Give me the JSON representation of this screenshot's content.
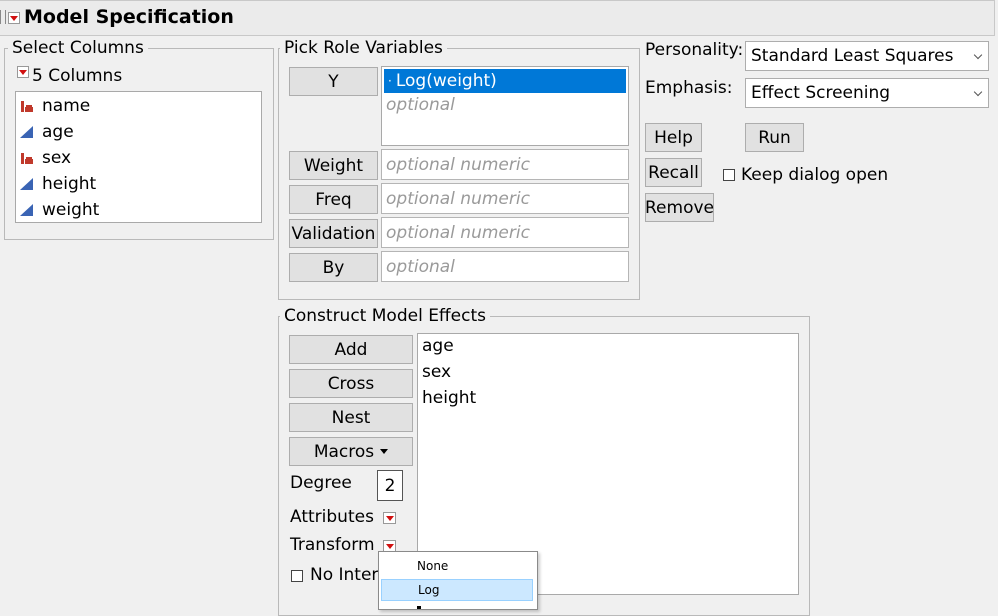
{
  "window": {
    "title": "Model Specification"
  },
  "select_columns": {
    "label": "Select Columns",
    "count_label": "5 Columns",
    "columns": [
      {
        "name": "name",
        "modeling_type": "nominal"
      },
      {
        "name": "age",
        "modeling_type": "continuous"
      },
      {
        "name": "sex",
        "modeling_type": "nominal"
      },
      {
        "name": "height",
        "modeling_type": "continuous"
      },
      {
        "name": "weight",
        "modeling_type": "continuous"
      }
    ]
  },
  "roles": {
    "label": "Pick Role Variables",
    "y_button": "Y",
    "y_selected": "Log(weight)",
    "y_placeholder": "optional",
    "weight_button": "Weight",
    "weight_placeholder": "optional numeric",
    "freq_button": "Freq",
    "freq_placeholder": "optional numeric",
    "validation_button": "Validation",
    "validation_placeholder": "optional numeric",
    "by_button": "By",
    "by_placeholder": "optional"
  },
  "options": {
    "personality_label": "Personality:",
    "personality_value": "Standard Least Squares",
    "emphasis_label": "Emphasis:",
    "emphasis_value": "Effect Screening",
    "help_button": "Help",
    "run_button": "Run",
    "recall_button": "Recall",
    "remove_button": "Remove",
    "keep_dialog_open_label": "Keep dialog open",
    "keep_dialog_open_checked": false
  },
  "effects": {
    "label": "Construct Model Effects",
    "add_button": "Add",
    "cross_button": "Cross",
    "nest_button": "Nest",
    "macros_button": "Macros",
    "degree_label": "Degree",
    "degree_value": "2",
    "attributes_label": "Attributes",
    "transform_label": "Transform",
    "no_intercept_label": "No Inter",
    "items": [
      "age",
      "sex",
      "height"
    ]
  },
  "transform_menu": {
    "items": [
      "None",
      "Log"
    ],
    "highlighted": "Log"
  },
  "colors": {
    "selection": "#0078d7",
    "menu_highlight": "#cce8ff",
    "triangle": "#d01010",
    "nominal_icon": "#c0392b",
    "continuous_icon": "#3a64b4"
  }
}
